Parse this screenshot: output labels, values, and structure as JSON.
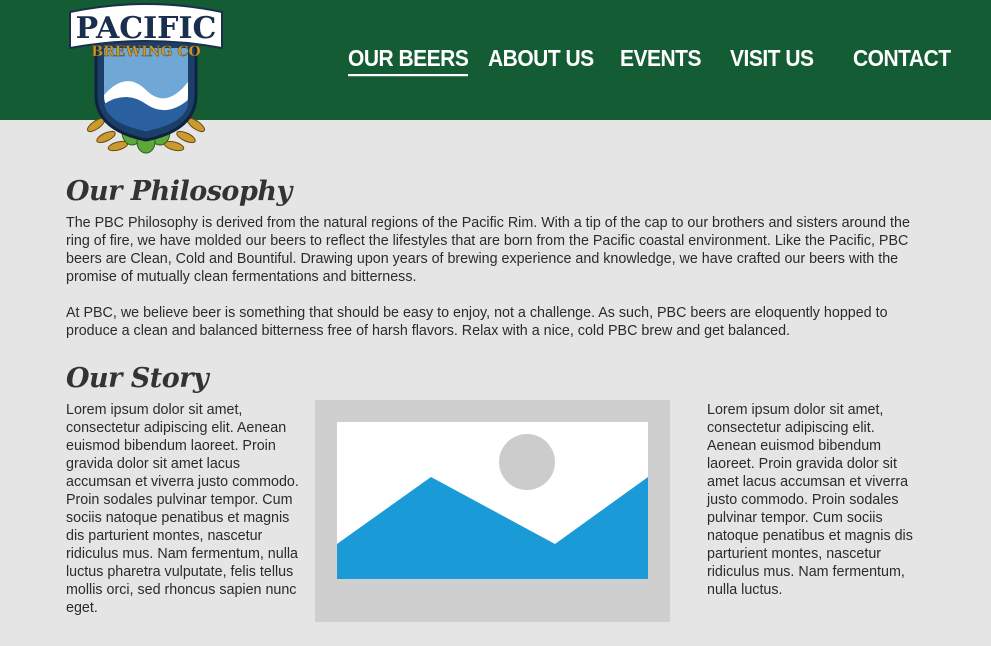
{
  "logo": {
    "text_top": "PACIFIC",
    "text_bottom": "BREWING CO"
  },
  "nav": {
    "items": [
      {
        "label": "OUR BEERS",
        "active": true
      },
      {
        "label": "ABOUT US",
        "active": false
      },
      {
        "label": "EVENTS",
        "active": false
      },
      {
        "label": "VISIT US",
        "active": false
      },
      {
        "label": "CONTACT",
        "active": false
      }
    ]
  },
  "philosophy": {
    "heading": "Our Philosophy",
    "paragraphs": [
      "The PBC Philosophy is derived from the natural regions of the Pacific Rim. With a tip of the cap to our brothers and sisters around the ring of fire, we have molded our beers to reflect the lifestyles that are born from the Pacific coastal environment. Like the Pacific, PBC beers are Clean, Cold and Bountiful. Drawing upon years of brewing experience and knowledge, we have crafted our beers with the promise of mutually clean fermentations and bitterness.",
      "At PBC, we believe beer is something that should be easy to enjoy, not a challenge. As such, PBC beers are eloquently hopped to produce a clean and balanced bitterness free of harsh flavors. Relax with a nice, cold PBC brew and get balanced."
    ]
  },
  "story": {
    "heading": "Our Story",
    "left_text": "Lorem ipsum dolor sit amet, consectetur adipiscing elit. Aenean euismod bibendum laoreet. Proin gravida dolor sit amet lacus accumsan et viverra justo commodo. Proin sodales pulvinar tempor. Cum sociis natoque penatibus et magnis dis parturient montes, nascetur ridiculus mus. Nam fermentum, nulla luctus pharetra vulputate, felis tellus mollis orci, sed rhoncus sapien nunc eget.",
    "right_text": "Lorem ipsum dolor sit amet, consectetur adipiscing elit. Aenean euismod bibendum laoreet. Proin gravida dolor sit amet lacus accumsan et viverra justo commodo. Proin sodales pulvinar tempor. Cum sociis natoque penatibus et magnis dis parturient montes, nascetur ridiculus mus. Nam fermentum, nulla luctus."
  },
  "colors": {
    "header_green": "#145c34",
    "page_bg": "#e5e5e5",
    "placeholder_blue": "#1a9ad6",
    "placeholder_sun": "#cccccc"
  },
  "icons": {
    "placeholder": "image-placeholder-icon"
  }
}
